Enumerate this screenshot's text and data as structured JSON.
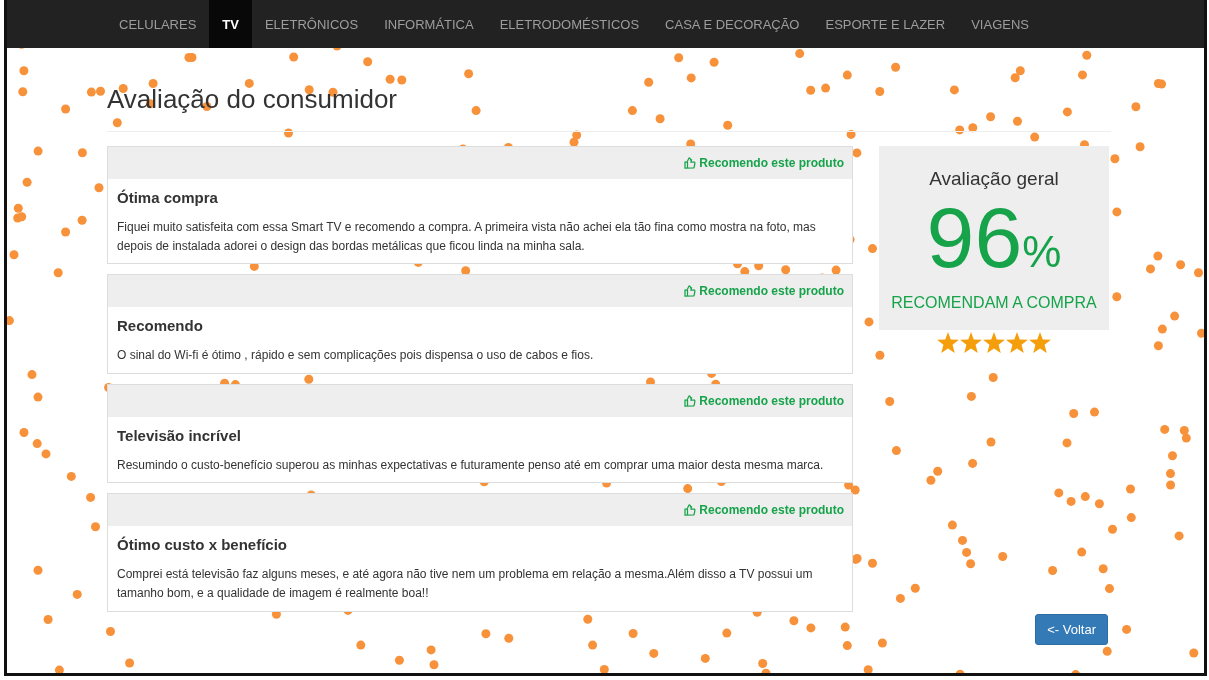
{
  "nav": {
    "items": [
      {
        "label": "CELULARES",
        "selected": false
      },
      {
        "label": "TV",
        "selected": true
      },
      {
        "label": "ELETRÔNICOS",
        "selected": false
      },
      {
        "label": "INFORMÁTICA",
        "selected": false
      },
      {
        "label": "ELETRODOMÉSTICOS",
        "selected": false
      },
      {
        "label": "CASA E DECORAÇÃO",
        "selected": false
      },
      {
        "label": "ESPORTE E LAZER",
        "selected": false
      },
      {
        "label": "VIAGENS",
        "selected": false
      }
    ]
  },
  "page_title": "Avaliação do consumidor",
  "reviews": [
    {
      "recommend": "Recomendo este produto",
      "title": "Ótima compra",
      "text": "Fiquei muito satisfeita com essa Smart TV e recomendo a compra. A primeira vista não achei ela tão fina como mostra na foto, mas depois de instalada adorei o design das bordas metálicas que ficou linda na minha sala."
    },
    {
      "recommend": "Recomendo este produto",
      "title": "Recomendo",
      "text": "O sinal do Wi-fi é ótimo , rápido e sem complicações pois dispensa o uso de cabos e fios."
    },
    {
      "recommend": "Recomendo este produto",
      "title": "Televisão incrível",
      "text": "Resumindo o custo-benefício superou as minhas expectativas e futuramente penso até em comprar uma maior desta mesma marca."
    },
    {
      "recommend": "Recomendo este produto",
      "title": "Ótimo custo x benefício",
      "text": "Comprei está televisão faz alguns meses, e até agora não tive nem um problema em relação a mesma.Além disso a TV possui um tamanho bom, e a qualidade de imagem é realmente boa!!"
    }
  ],
  "summary": {
    "title": "Avaliação geral",
    "value": "96",
    "unit": "%",
    "caption": "RECOMENDAM A COMPRA",
    "stars": 5
  },
  "back_button": "<- Voltar"
}
